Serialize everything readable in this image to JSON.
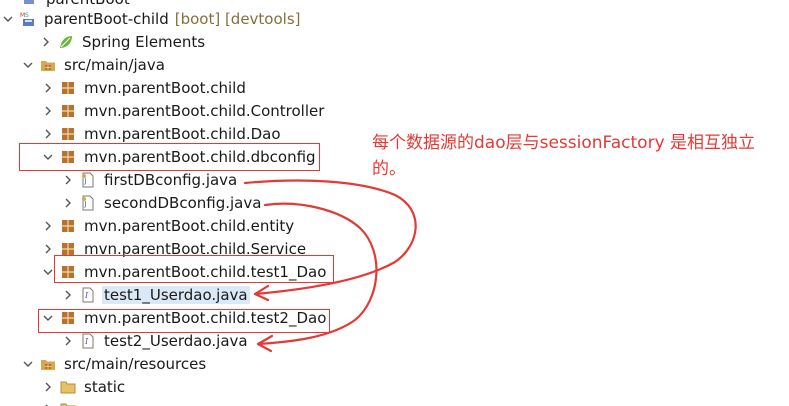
{
  "tree": {
    "partial_top": "parentBoot",
    "project": {
      "name": "parentBoot-child",
      "suffix": "[boot] [devtools]"
    },
    "spring_elements": "Spring Elements",
    "src_main_java": "src/main/java",
    "packages": {
      "child": "mvn.parentBoot.child",
      "controller": "mvn.parentBoot.child.Controller",
      "dao": "mvn.parentBoot.child.Dao",
      "dbconfig": "mvn.parentBoot.child.dbconfig",
      "entity": "mvn.parentBoot.child.entity",
      "service": "mvn.parentBoot.child.Service",
      "test1_dao": "mvn.parentBoot.child.test1_Dao",
      "test2_dao": "mvn.parentBoot.child.test2_Dao"
    },
    "files": {
      "first_db_config": "firstDBconfig.java",
      "second_db_config": "secondDBconfig.java",
      "test1_userdao": "test1_Userdao.java",
      "test2_userdao": "test2_Userdao.java"
    },
    "src_main_resources": "src/main/resources",
    "static_folder": "static"
  },
  "annotation": {
    "note": "每个数据源的dao层与sessionFactory 是相互独立的。",
    "color": "#e53935"
  },
  "colors": {
    "package": "#b5732f",
    "folder": "#d8a84e",
    "java_file": "#3a64b5",
    "spring": "#6db33f",
    "selection": "#dbe9f7"
  },
  "icons": {
    "expanded": "chevron-down-icon",
    "collapsed": "chevron-right-icon",
    "project": "maven-project-icon",
    "spring": "spring-leaf-icon",
    "source_folder": "source-folder-icon",
    "package": "package-icon",
    "java_class": "java-class-file-icon",
    "java_interface": "java-interface-file-icon",
    "folder": "folder-icon"
  }
}
